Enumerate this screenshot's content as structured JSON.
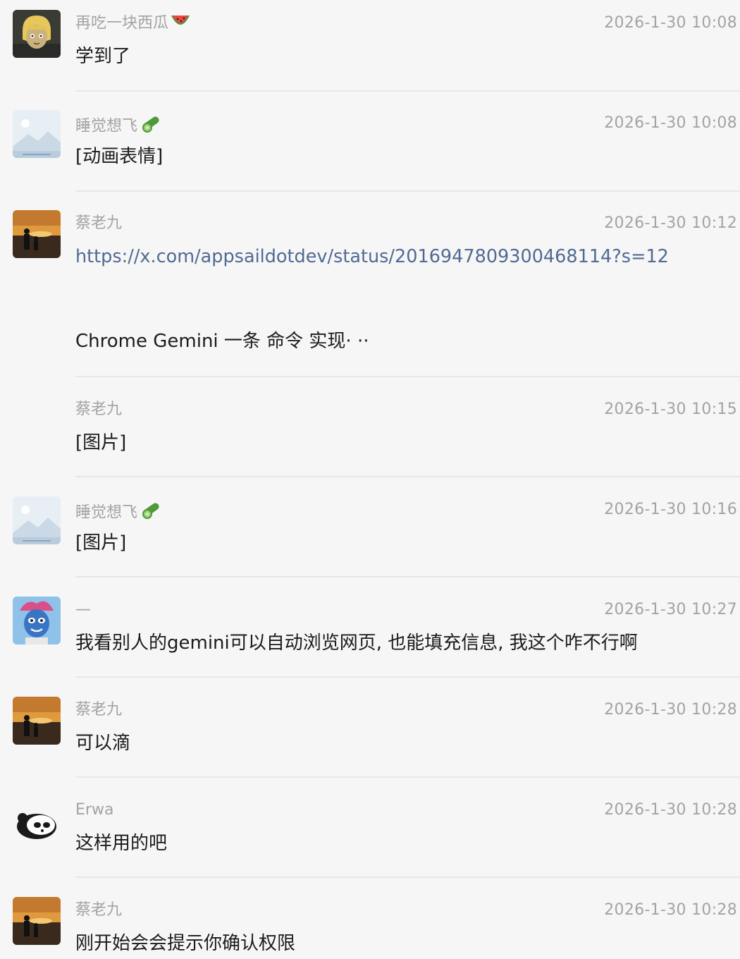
{
  "messages": [
    {
      "sender": "再吃一块西瓜",
      "sender_emoji": "watermelon-icon",
      "time": "2026-1-30 10:08",
      "text": "学到了"
    },
    {
      "sender": "睡觉想飞",
      "sender_emoji": "cucumber-icon",
      "time": "2026-1-30 10:08",
      "text": "[动画表情]"
    },
    {
      "sender": "蔡老九",
      "time": "2026-1-30 10:12",
      "text": "https://x.com/appsaildotdev/status/2016947809300468114?s=12",
      "text_line2": "Chrome   Gemini  一条 命令 实现· ··"
    },
    {
      "sender": "蔡老九",
      "time": "2026-1-30 10:15",
      "text": "[图片]"
    },
    {
      "sender": "睡觉想飞",
      "sender_emoji": "cucumber-icon",
      "time": "2026-1-30 10:16",
      "text": "[图片]"
    },
    {
      "sender": "—",
      "time": "2026-1-30 10:27",
      "text": "我看别人的gemini可以自动浏览网页, 也能填充信息, 我这个咋不行啊"
    },
    {
      "sender": "蔡老九",
      "time": "2026-1-30 10:28",
      "text": "可以滴"
    },
    {
      "sender": "Erwa",
      "time": "2026-1-30 10:28",
      "text": "这样用的吧"
    },
    {
      "sender": "蔡老九",
      "time": "2026-1-30 10:28",
      "text": "刚开始会会提示你确认权限"
    }
  ],
  "colors": {
    "background": "#f6f6f6",
    "sender_text": "#a3a3a3",
    "message_text": "#1b1b1b",
    "link_text": "#516a93",
    "divider": "#e7e7e7"
  }
}
